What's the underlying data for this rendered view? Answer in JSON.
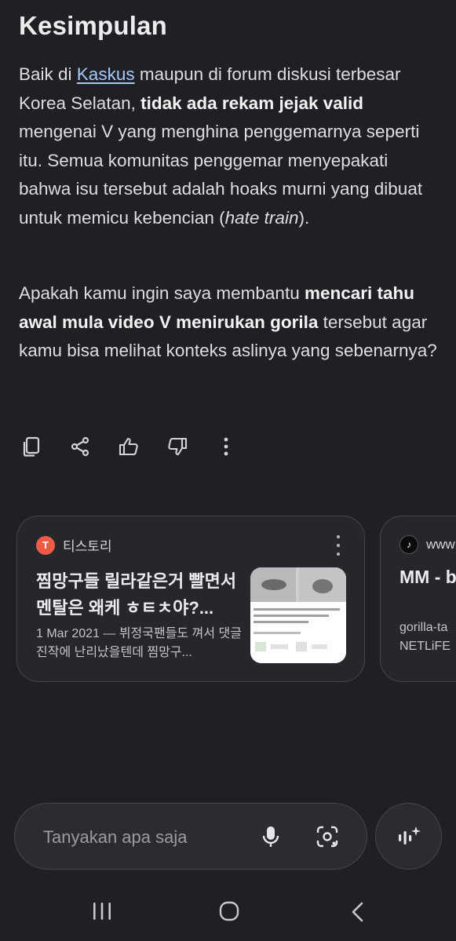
{
  "conclusion": {
    "heading": "Kesimpulan",
    "para1": {
      "t1": "Baik di ",
      "link": "Kaskus",
      "t2": " maupun di forum diskusi terbesar Korea Selatan, ",
      "bold": "tidak ada rekam jejak valid",
      "t3": " mengenai V yang menghina penggemarnya seperti itu. Semua komunitas penggemar menyepakati bahwa isu tersebut adalah hoaks murni yang dibuat untuk memicu kebencian (",
      "italic": "hate train",
      "t4": ")."
    },
    "para2": {
      "t1": "Apakah kamu ingin saya membantu ",
      "bold": "mencari tahu awal mula video V menirukan gorila",
      "t2": " tersebut agar kamu bisa melihat konteks aslinya yang sebenarnya?"
    }
  },
  "actions": {
    "copy": "copy-icon",
    "share": "share-icon",
    "like": "thumbs-up-icon",
    "dislike": "thumbs-down-icon",
    "more": "more-vert-icon"
  },
  "sources": [
    {
      "site": "티스토리",
      "favicon_letter": "T",
      "title": "찜망구들 릴라같은거 빨면서 멘탈은 왜케 ㅎㅌㅊ야?...",
      "snippet": "1 Mar 2021 — 뷔정국팬들도 껴서 댓글 진작에 난리났을텐데 찜망구..."
    },
    {
      "site": "www",
      "favicon_letter": "♪",
      "title": "MM - b",
      "snippet_line1": "gorilla-ta",
      "snippet_line2": "NETLiFE"
    }
  ],
  "input": {
    "placeholder": "Tanyakan apa saja",
    "mic": "mic-icon",
    "lens": "lens-icon",
    "live": "live-sparkle-icon"
  },
  "colors": {
    "background": "#1f2024",
    "card": "#26272c",
    "link": "#a9c7fa",
    "favicon_tistory": "#eb5b46"
  }
}
